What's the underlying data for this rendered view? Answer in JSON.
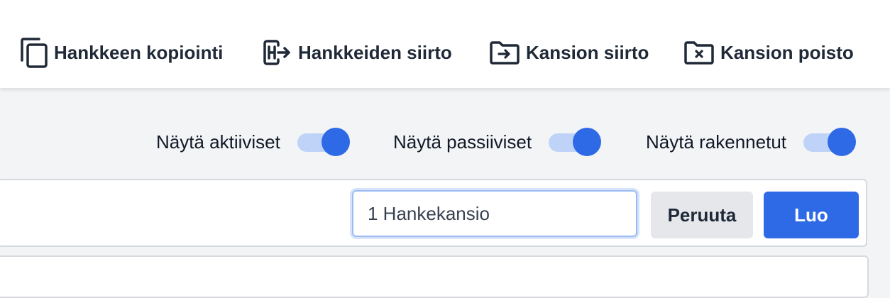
{
  "toolbar": {
    "copy_project": {
      "label": "Hankkeen kopiointi",
      "icon": "copy-icon"
    },
    "move_projects": {
      "label": "Hankkeiden siirto",
      "icon": "move-project-icon"
    },
    "move_folder": {
      "label": "Kansion siirto",
      "icon": "folder-move-icon"
    },
    "delete_folder": {
      "label": "Kansion poisto",
      "icon": "folder-delete-icon"
    }
  },
  "filters": [
    {
      "label": "Näytä aktiiviset",
      "on": true
    },
    {
      "label": "Näytä passiiviset",
      "on": true
    },
    {
      "label": "Näytä rakennetut",
      "on": true
    }
  ],
  "create_folder": {
    "input_value": "1 Hankekansio",
    "cancel_label": "Peruuta",
    "create_label": "Luo"
  },
  "colors": {
    "accent": "#2f6ae6",
    "toggle_track": "#bfd3f8",
    "cancel_bg": "#e5e7eb",
    "background": "#f3f4f6"
  }
}
